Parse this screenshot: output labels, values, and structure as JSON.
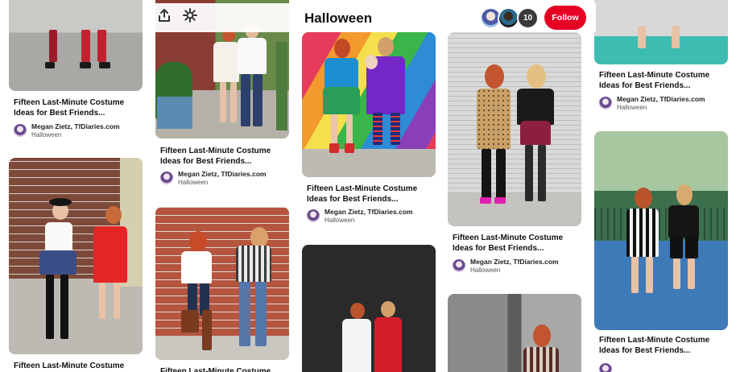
{
  "board": {
    "title": "Halloween",
    "collaborator_count": "10",
    "follow_label": "Follow"
  },
  "icons": {
    "share": "share-icon",
    "sparkle": "sparkle-icon"
  },
  "pin": {
    "title": "Fifteen Last-Minute Costume Ideas for Best Friends...",
    "title_short": "Fifteen Last-Minute Costume Ideas",
    "author": "Megan Zietz, TfDiaries.com",
    "board_name": "Halloween"
  },
  "colors": {
    "follow_red": "#e60023",
    "text_dark": "#111111"
  }
}
